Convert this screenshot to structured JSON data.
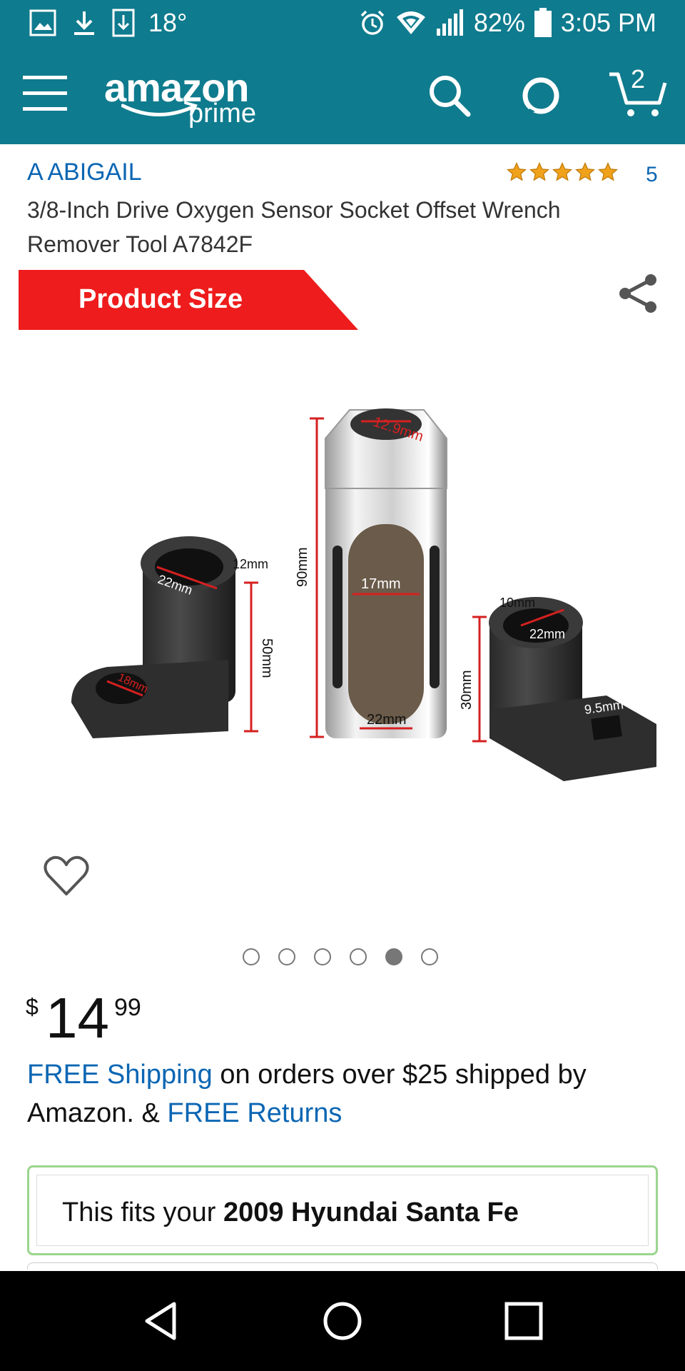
{
  "status_bar": {
    "temperature": "18°",
    "battery": "82%",
    "time": "3:05 PM"
  },
  "header": {
    "logo_word": "amazon",
    "logo_sub": "prime",
    "cart_count": "2"
  },
  "product": {
    "brand": "A ABIGAIL",
    "rating": 5,
    "rating_count": "5",
    "title": "3/8-Inch Drive Oxygen Sensor Socket Offset Wrench Remover Tool A7842F"
  },
  "image": {
    "banner": "Product Size",
    "dimension_labels": {
      "top": "12.9mm",
      "height_center": "90mm",
      "center_inner": "17mm",
      "center_bottom": "22mm",
      "left_side": "12mm",
      "left_inner": "22mm",
      "left_height": "50mm",
      "left_base": "18mm",
      "right_side": "10mm",
      "right_inner": "22mm",
      "right_height": "30mm",
      "right_base": "9.5mm"
    },
    "carousel_count": 6,
    "carousel_active": 5
  },
  "price": {
    "currency": "$",
    "whole": "14",
    "fraction": "99"
  },
  "shipping": {
    "free_shipping_link": "FREE Shipping",
    "middle_text": " on orders over $25 shipped by Amazon. & ",
    "free_returns_link": "FREE Returns"
  },
  "fitment": {
    "prefix": "This fits your ",
    "vehicle": "2009 Hyundai Santa Fe"
  },
  "colors": {
    "header_bg": "#0f7b8e",
    "link": "#0b66b3",
    "star": "#f0a21b",
    "banner_red": "#ee1c1c",
    "fits_border": "#9bd58e"
  }
}
